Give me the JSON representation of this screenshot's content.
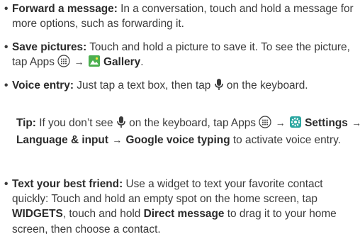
{
  "bullets": {
    "forward": {
      "title": "Forward a message:",
      "line1": "In a conversation, touch and hold a",
      "line2": "message for more options, such as forwarding it."
    },
    "save": {
      "title": "Save pictures:",
      "text1": "Touch and hold a picture to save it. To see",
      "text2": "the picture, tap Apps",
      "arrow": "→",
      "gallery": "Gallery",
      "end": "."
    },
    "voice": {
      "title": "Voice entry:",
      "text1": "Just tap a text box, then tap",
      "text2": "on the",
      "line2": "keyboard."
    },
    "text_friend": {
      "title": "Text your best friend:",
      "l1": "Use a widget to text your favorite",
      "l2": "contact quickly: Touch and hold an empty spot on the home",
      "l3a": "screen, tap",
      "widgets": "WIDGETS",
      "l3b": ", touch and hold",
      "direct": "Direct message",
      "l3c": "to",
      "l4": "drag it to your home screen, then choose a contact."
    }
  },
  "tip": {
    "label": "Tip:",
    "t1": "If you don’t see",
    "t2": "on the keyboard, tap Apps",
    "arrow": "→",
    "settings": "Settings",
    "language": "Language & input",
    "google": "Google voice typing",
    "t3": "to",
    "t4": "activate voice entry."
  },
  "bullet_char": "•",
  "icons": {
    "apps": "apps-icon",
    "gallery": "gallery-icon",
    "mic": "microphone-icon",
    "settings": "settings-icon"
  },
  "colors": {
    "text": "#3a3a3a",
    "gallery_green": "#4caf50",
    "settings_teal": "#2aa6a0"
  }
}
